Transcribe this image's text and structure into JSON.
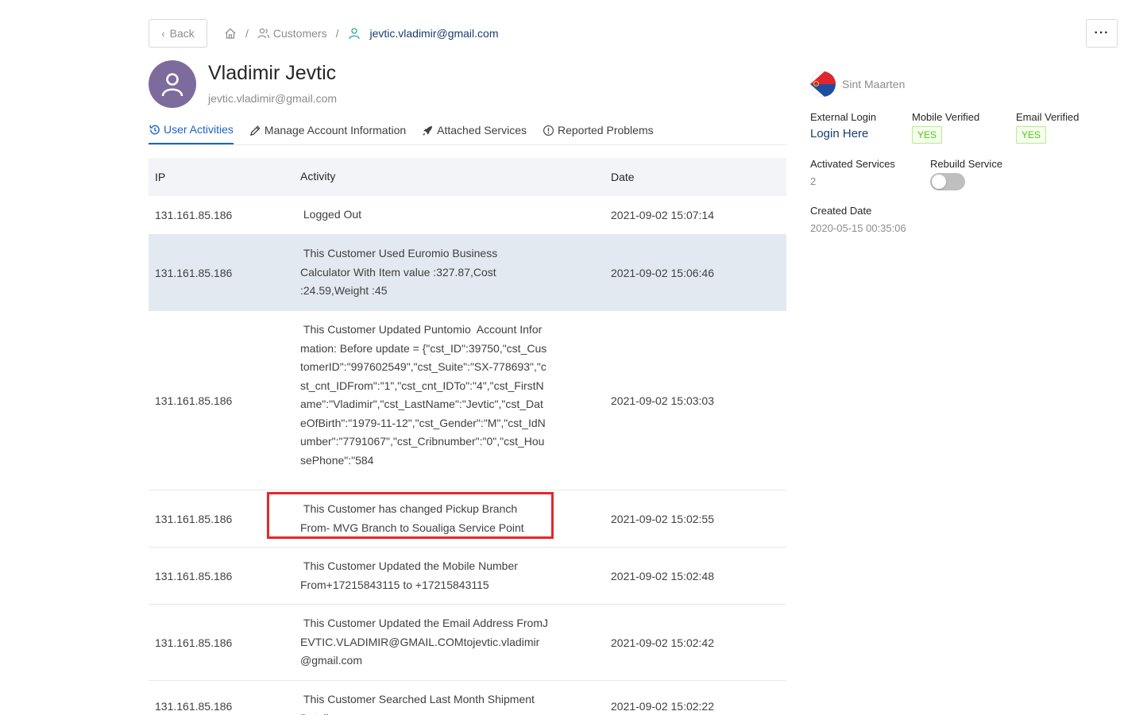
{
  "header": {
    "back_label": "Back",
    "breadcrumb": [
      {
        "label": "",
        "icon": "home-icon"
      },
      {
        "label": "Customers",
        "icon": "users-icon"
      },
      {
        "label": "jevtic.vladimir@gmail.com",
        "icon": "user-icon"
      }
    ],
    "separator": "/",
    "more_label": "···"
  },
  "profile": {
    "name": "Vladimir Jevtic",
    "email": "jevtic.vladimir@gmail.com"
  },
  "tabs": [
    {
      "label": "User Activities",
      "icon": "history-icon",
      "active": true
    },
    {
      "label": "Manage Account Information",
      "icon": "edit-icon",
      "active": false
    },
    {
      "label": "Attached Services",
      "icon": "rocket-icon",
      "active": false
    },
    {
      "label": "Reported Problems",
      "icon": "info-icon",
      "active": false
    }
  ],
  "table": {
    "headers": [
      "IP",
      "Activity",
      "Date"
    ],
    "rows": [
      {
        "ip": "131.161.85.186",
        "activity": " Logged Out",
        "date": "2021-09-02 15:07:14"
      },
      {
        "ip": "131.161.85.186",
        "activity": " This Customer Used Euromio Business Calculator With Item value :327.87,Cost :24.59,Weight :45",
        "date": "2021-09-02 15:06:46"
      },
      {
        "ip": "131.161.85.186",
        "activity": " This Customer Updated Puntomio  Account Information: Before update = {\"cst_ID\":39750,\"cst_CustomerID\":\"997602549\",\"cst_Suite\":\"SX-778693\",\"cst_cnt_IDFrom\":\"1\",\"cst_cnt_IDTo\":\"4\",\"cst_FirstName\":\"Vladimir\",\"cst_LastName\":\"Jevtic\",\"cst_DateOfBirth\":\"1979-11-12\",\"cst_Gender\":\"M\",\"cst_IdNumber\":\"7791067\",\"cst_Cribnumber\":\"0\",\"cst_HousePhone\":\"584",
        "date": "2021-09-02 15:03:03"
      },
      {
        "ip": "131.161.85.186",
        "activity": " This Customer has changed Pickup Branch From- MVG Branch to Soualiga Service Point",
        "date": "2021-09-02 15:02:55"
      },
      {
        "ip": "131.161.85.186",
        "activity": " This Customer Updated the Mobile Number From+17215843115 to +17215843115",
        "date": "2021-09-02 15:02:48"
      },
      {
        "ip": "131.161.85.186",
        "activity": " This Customer Updated the Email Address FromJEVTIC.VLADIMIR@GMAIL.COMtojevtic.vladimir@gmail.com",
        "date": "2021-09-02 15:02:42"
      },
      {
        "ip": "131.161.85.186",
        "activity": " This Customer Searched Last Month Shipment Details",
        "date": "2021-09-02 15:02:22"
      }
    ]
  },
  "side": {
    "country": "Sint Maarten",
    "external_login_label": "External Login",
    "external_login_link": "Login Here",
    "mobile_verified_label": "Mobile Verified",
    "mobile_verified_value": "YES",
    "email_verified_label": "Email Verified",
    "email_verified_value": "YES",
    "activated_services_label": "Activated Services",
    "activated_services_value": "2",
    "rebuild_service_label": "Rebuild Service",
    "rebuild_service_on": false,
    "created_date_label": "Created Date",
    "created_date_value": "2020-05-15 00:35:06"
  },
  "colors": {
    "accent": "#1d63c4",
    "link": "#1a3d6e",
    "highlight_row": "#e3e9f0",
    "annotation_box": "#e8262b",
    "avatar": "#7d6b9e"
  }
}
